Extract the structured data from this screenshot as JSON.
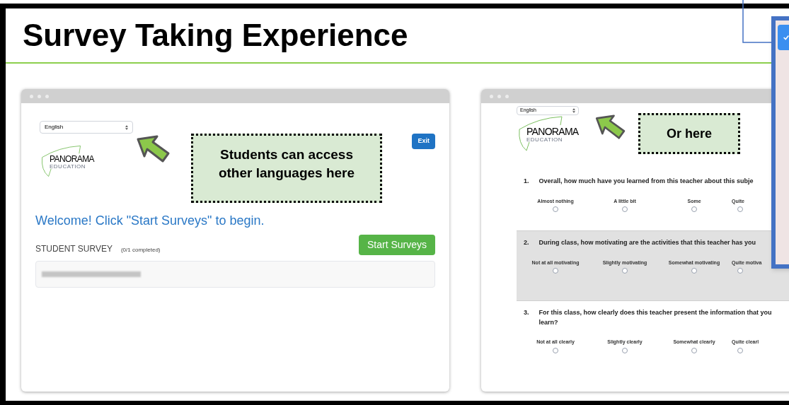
{
  "slide": {
    "title": "Survey Taking Experience"
  },
  "left_window": {
    "language_select": {
      "value": "English"
    },
    "logo": {
      "name": "PANORAMA",
      "tagline": "EDUCATION"
    },
    "callout": "Students can access other languages here",
    "exit_button": "Exit",
    "welcome": "Welcome! Click \"Start Surveys\" to begin.",
    "survey": {
      "label": "STUDENT SURVEY",
      "progress": "(0/1 completed)"
    },
    "start_button": "Start Surveys"
  },
  "right_window": {
    "language_select": {
      "value": "English"
    },
    "logo": {
      "name": "PANORAMA",
      "tagline": "EDUCATION"
    },
    "callout": "Or here",
    "questions": [
      {
        "number": "1.",
        "text": "Overall, how much have you learned from this teacher about this subje",
        "highlighted": false,
        "options": [
          {
            "label": "Almost nothing",
            "selected": false
          },
          {
            "label": "A little bit",
            "selected": false
          },
          {
            "label": "Some",
            "selected": false
          },
          {
            "label": "Quite",
            "selected": false
          }
        ]
      },
      {
        "number": "2.",
        "text": "During class, how motivating are the activities that this teacher has you",
        "highlighted": true,
        "options": [
          {
            "label": "Not at all motivating",
            "selected": false
          },
          {
            "label": "Slightly motivating",
            "selected": false
          },
          {
            "label": "Somewhat motivating",
            "selected": false
          },
          {
            "label": "Quite motiva",
            "selected": false
          }
        ]
      },
      {
        "number": "3.",
        "text": "For this class, how clearly does this teacher present the information that you learn?",
        "highlighted": false,
        "options": [
          {
            "label": "Not at all clearly",
            "selected": false
          },
          {
            "label": "Slightly clearly",
            "selected": false
          },
          {
            "label": "Somewhat clearly",
            "selected": false
          },
          {
            "label": "Quite clearl",
            "selected": false
          }
        ]
      }
    ]
  }
}
